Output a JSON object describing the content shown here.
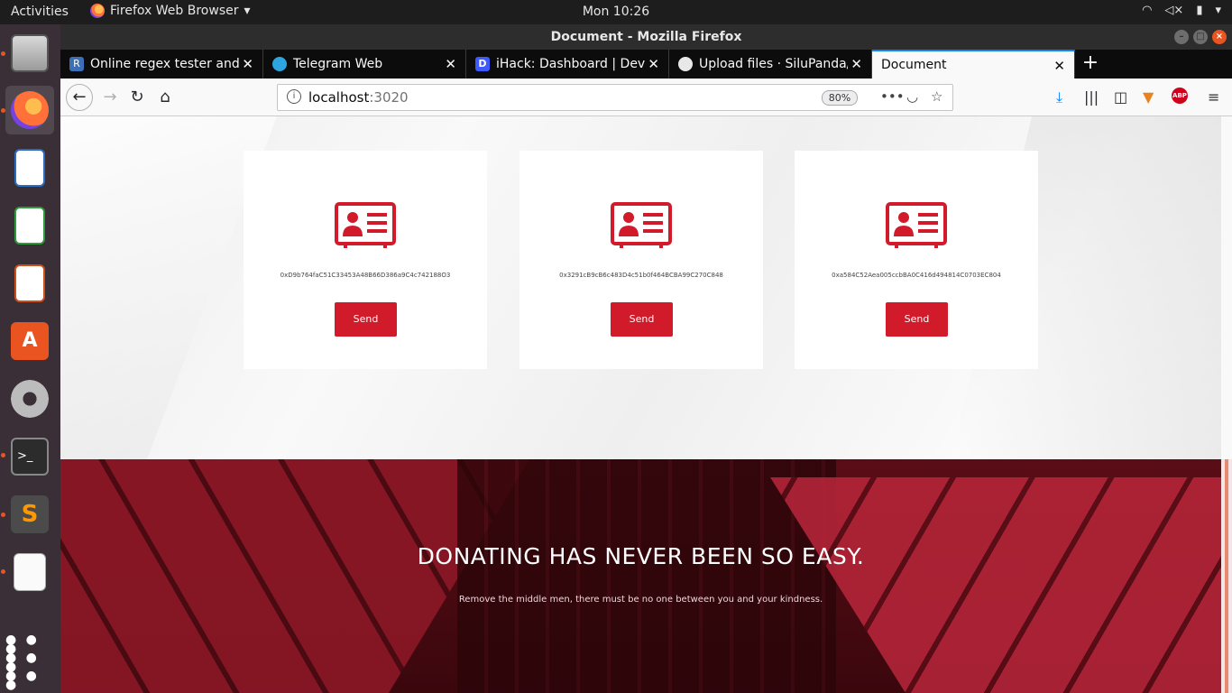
{
  "topbar": {
    "activities": "Activities",
    "app_menu": "Firefox Web Browser",
    "clock": "Mon 10:26"
  },
  "window": {
    "title": "Document - Mozilla Firefox"
  },
  "tabs": [
    {
      "title": "Online regex tester and d",
      "favicon_color": "#3b6fb6",
      "favicon": "R"
    },
    {
      "title": "Telegram Web",
      "favicon_color": "#2ca5e0",
      "favicon": "paper-plane-icon"
    },
    {
      "title": "iHack: Dashboard | Devfo",
      "favicon_color": "#3d5afe",
      "favicon": "D"
    },
    {
      "title": "Upload files · SiluPanda/",
      "favicon_color": "#e8e8e8",
      "favicon": "github-icon"
    },
    {
      "title": "Document",
      "favicon_color": "",
      "favicon": ""
    }
  ],
  "urlbar": {
    "host": "localhost",
    "port": ":3020",
    "zoom": "80%"
  },
  "cards": [
    {
      "address": "0xD9b764faC51C33453A48B66D386a9C4c742188O3",
      "button": "Send"
    },
    {
      "address": "0x3291cB9cB6c483D4c51b0f464BCBA99C270C848",
      "button": "Send"
    },
    {
      "address": "0xa584C52Aea005ccbBA0C416d494814C0703EC804",
      "button": "Send"
    }
  ],
  "hero": {
    "heading": "DONATING HAS NEVER BEEN SO EASY.",
    "subtext": "Remove the middle men, there must be no one between you and your kindness."
  },
  "colors": {
    "accent": "#d11a2a",
    "ubuntu_orange": "#e95420",
    "tab_highlight": "#0a84ff"
  }
}
